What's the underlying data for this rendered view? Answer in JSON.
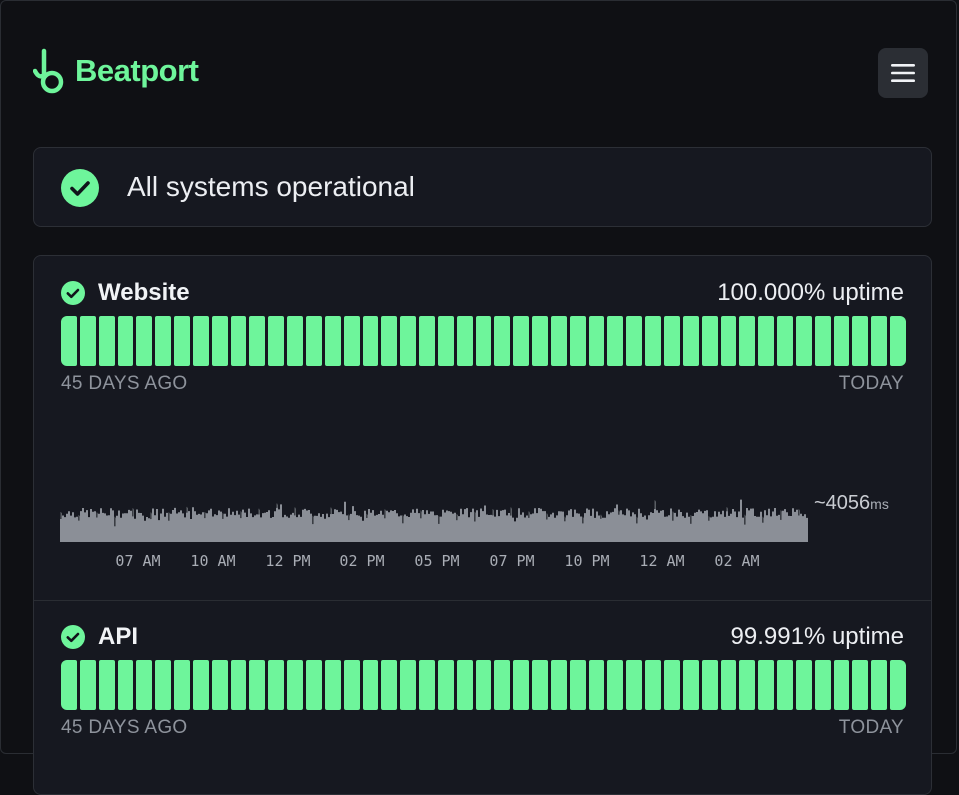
{
  "brand": {
    "name": "Beatport",
    "accent": "#6ef59b"
  },
  "header": {
    "menu_icon": "hamburger-icon"
  },
  "status": {
    "text": "All systems operational",
    "icon": "check-circle-icon"
  },
  "components": [
    {
      "name": "Website",
      "uptime": "100.000% uptime",
      "bar_start_label": "45 DAYS AGO",
      "bar_end_label": "TODAY",
      "response_time": {
        "value": "~4056",
        "unit": "ms"
      },
      "time_ticks": [
        "07 AM",
        "10 AM",
        "12 PM",
        "02 PM",
        "05 PM",
        "07 PM",
        "10 PM",
        "12 AM",
        "02 AM"
      ]
    },
    {
      "name": "API",
      "uptime": "99.991% uptime",
      "bar_start_label": "45 DAYS AGO",
      "bar_end_label": "TODAY"
    }
  ]
}
